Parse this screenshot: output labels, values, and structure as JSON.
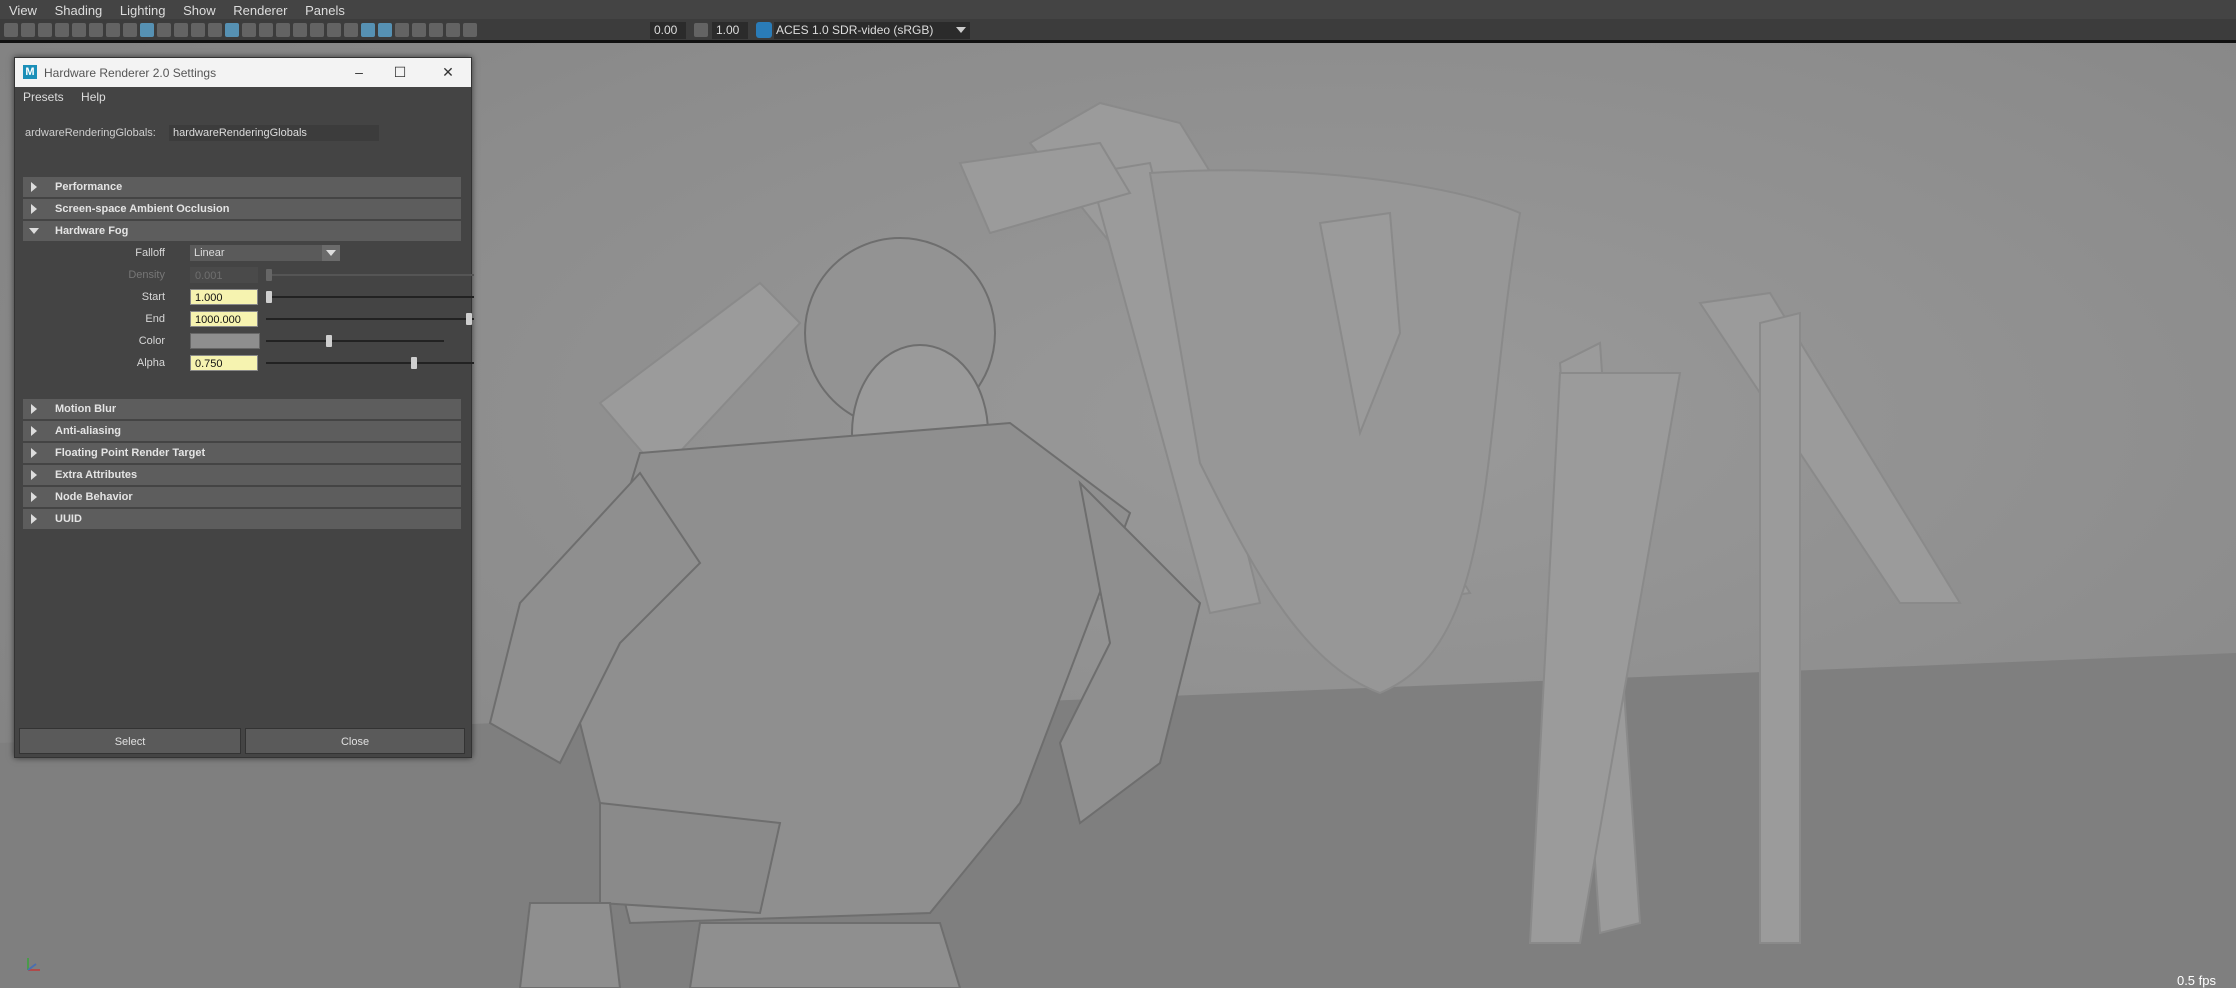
{
  "menubar": {
    "items": [
      "View",
      "Shading",
      "Lighting",
      "Show",
      "Renderer",
      "Panels"
    ]
  },
  "toolbar": {
    "exposure": "0.00",
    "gamma": "1.00",
    "color_space": "ACES 1.0 SDR-video (sRGB)"
  },
  "viewport": {
    "fps": "0.5 fps"
  },
  "window": {
    "title": "Hardware Renderer 2.0 Settings",
    "menu": [
      "Presets",
      "Help"
    ],
    "node_label": "ardwareRenderingGlobals:",
    "node_value": "hardwareRenderingGlobals",
    "sections_before": [
      "Performance",
      "Screen-space Ambient Occlusion"
    ],
    "open_section": "Hardware Fog",
    "fog": {
      "falloff_label": "Falloff",
      "falloff_value": "Linear",
      "density_label": "Density",
      "density_value": "0.001",
      "start_label": "Start",
      "start_value": "1.000",
      "end_label": "End",
      "end_value": "1000.000",
      "color_label": "Color",
      "alpha_label": "Alpha",
      "alpha_value": "0.750"
    },
    "sections_after": [
      "Motion Blur",
      "Anti-aliasing",
      "Floating Point Render Target",
      "Extra Attributes",
      "Node Behavior",
      "UUID"
    ],
    "select_label": "Select",
    "close_label": "Close"
  }
}
